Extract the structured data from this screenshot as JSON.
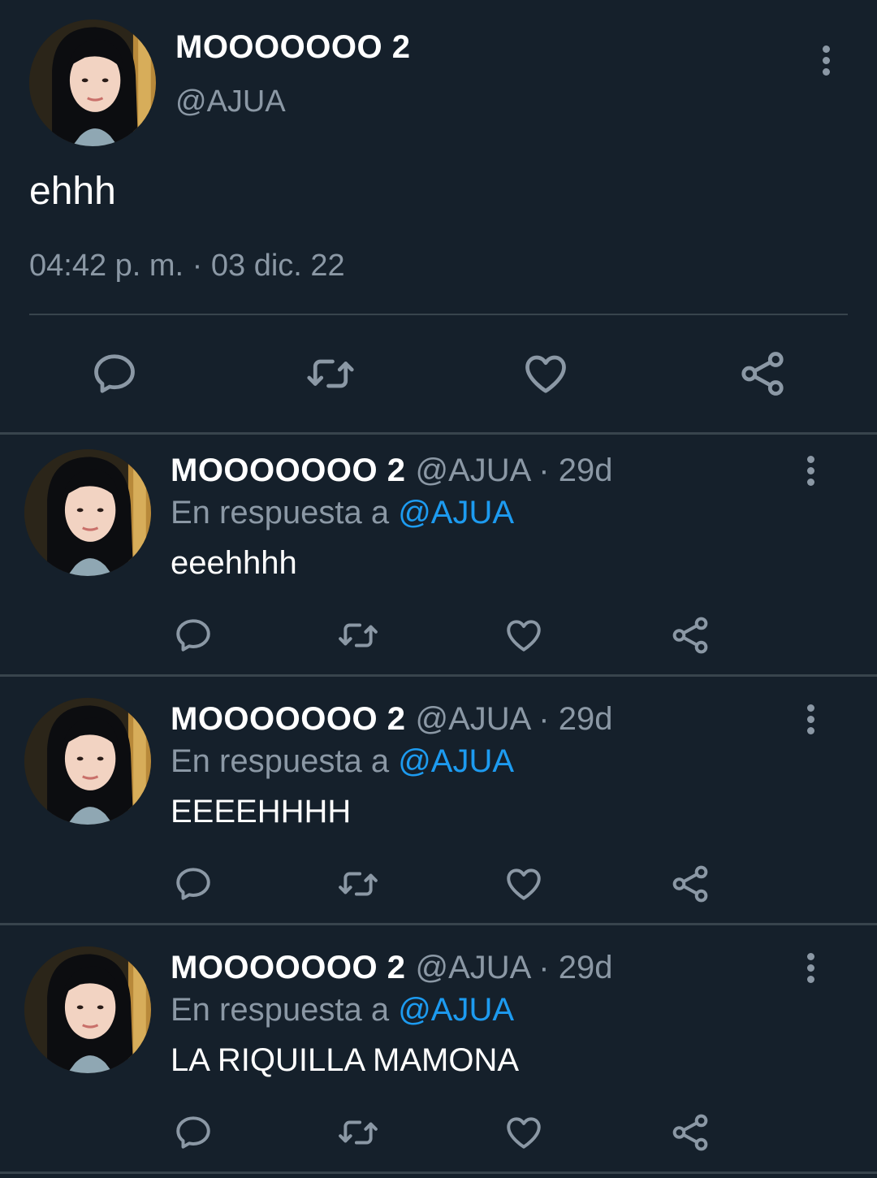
{
  "main_tweet": {
    "author_name": "MOOOOOOO 2",
    "author_handle": "@AJUA",
    "text": "ehhh",
    "timestamp": "04:42 p. m. · 03 dic. 22",
    "actions": [
      "reply-icon",
      "retweet-icon",
      "like-icon",
      "share-icon"
    ]
  },
  "replies": [
    {
      "author_name": "MOOOOOOO 2",
      "author_handle": "@AJUA",
      "separator": "·",
      "age": "29d",
      "in_reply_prefix": "En respuesta a ",
      "in_reply_to": "@AJUA",
      "text": "eeehhhh"
    },
    {
      "author_name": "MOOOOOOO 2",
      "author_handle": "@AJUA",
      "separator": "·",
      "age": "29d",
      "in_reply_prefix": "En respuesta a ",
      "in_reply_to": "@AJUA",
      "text": "EEEEHHHH"
    },
    {
      "author_name": "MOOOOOOO 2",
      "author_handle": "@AJUA",
      "separator": "·",
      "age": "29d",
      "in_reply_prefix": "En respuesta a ",
      "in_reply_to": "@AJUA",
      "text": "LA RIQUILLA MAMONA"
    }
  ],
  "colors": {
    "background": "#15202b",
    "primary_text": "#ffffff",
    "secondary_text": "#8b98a5",
    "link": "#1d9bf0",
    "divider": "#38444d"
  }
}
